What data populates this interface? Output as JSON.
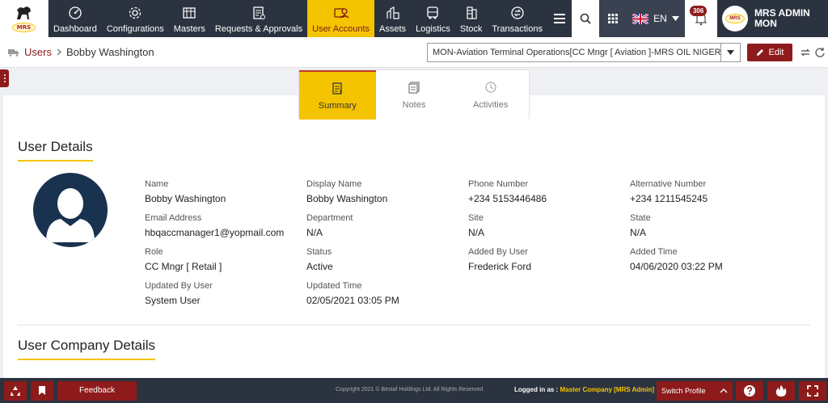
{
  "nav": {
    "items": [
      {
        "label": "Dashboard",
        "icon": "dashboard-icon"
      },
      {
        "label": "Configurations",
        "icon": "gear-icon"
      },
      {
        "label": "Masters",
        "icon": "masters-icon"
      },
      {
        "label": "Requests & Approvals",
        "icon": "requests-icon"
      },
      {
        "label": "User Accounts",
        "icon": "user-accounts-icon",
        "active": true
      },
      {
        "label": "Assets",
        "icon": "assets-icon"
      },
      {
        "label": "Logistics",
        "icon": "truck-icon"
      },
      {
        "label": "Stock",
        "icon": "stock-icon"
      },
      {
        "label": "Transactions",
        "icon": "transactions-icon"
      }
    ],
    "language": "EN",
    "notification_count": "306",
    "user_name": "MRS ADMIN",
    "user_sub": "MON",
    "logo_text": "MRS"
  },
  "breadcrumb": {
    "parent": "Users",
    "current": "Bobby Washington"
  },
  "context_select": {
    "value": "MON-Aviation Terminal Operations[CC Mngr [ Aviation ]-MRS OIL NIGERIA]"
  },
  "edit_label": "Edit",
  "tabs": [
    {
      "label": "Summary",
      "active": true
    },
    {
      "label": "Notes"
    },
    {
      "label": "Activities"
    }
  ],
  "user_details": {
    "title": "User Details",
    "fields": {
      "name": {
        "label": "Name",
        "value": "Bobby Washington"
      },
      "display_name": {
        "label": "Display Name",
        "value": "Bobby Washington"
      },
      "phone": {
        "label": "Phone Number",
        "value": "+234 5153446486"
      },
      "alt_phone": {
        "label": "Alternative Number",
        "value": "+234 1211545245"
      },
      "email": {
        "label": "Email Address",
        "value": "hbqaccmanager1@yopmail.com"
      },
      "department": {
        "label": "Department",
        "value": "N/A"
      },
      "site": {
        "label": "Site",
        "value": "N/A"
      },
      "state": {
        "label": "State",
        "value": "N/A"
      },
      "role": {
        "label": "Role",
        "value": "CC Mngr [ Retail ]"
      },
      "status": {
        "label": "Status",
        "value": "Active"
      },
      "added_by": {
        "label": "Added By User",
        "value": "Frederick Ford"
      },
      "added_time": {
        "label": "Added Time",
        "value": "04/06/2020 03:22 PM"
      },
      "updated_by": {
        "label": "Updated By User",
        "value": "System User"
      },
      "updated_time": {
        "label": "Updated Time",
        "value": "02/05/2021 03:05 PM"
      }
    }
  },
  "company_details": {
    "title": "User Company Details"
  },
  "footer": {
    "feedback_label": "Feedback",
    "copyright": "Copyright 2021 © Bestaf Holdings Ltd. All Rights Reserved",
    "logged_in_label": "Logged in as :",
    "logged_in_value": "Master Company [MRS Admin]",
    "switch_profile_label": "Switch Profile"
  },
  "colors": {
    "navbar": "#2c3340",
    "accent": "#f5c400",
    "brand": "#8e1b1b"
  }
}
